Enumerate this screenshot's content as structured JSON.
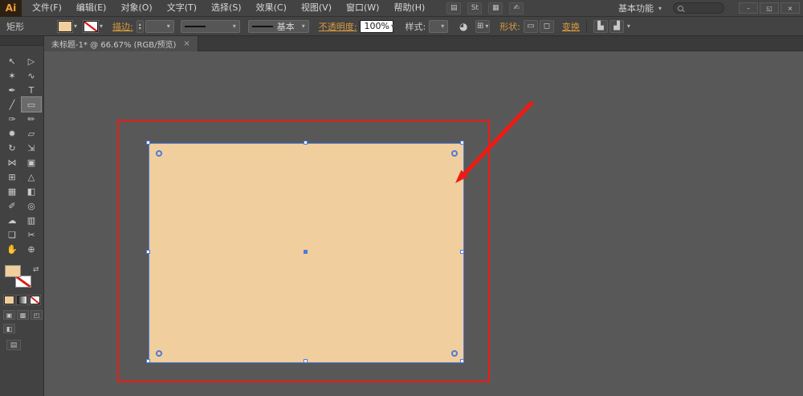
{
  "app": {
    "logo": "Ai"
  },
  "titlebar": {
    "menus": [
      "文件(F)",
      "编辑(E)",
      "对象(O)",
      "文字(T)",
      "选择(S)",
      "效果(C)",
      "视图(V)",
      "窗口(W)",
      "帮助(H)"
    ],
    "icons": {
      "arrange_documents": "▤",
      "st_badge": "St",
      "layout_picker": "▦",
      "cs_live": "✍",
      "caret": "▾"
    },
    "workspace": "基本功能",
    "search_placeholder": "",
    "window": {
      "minimize": "–",
      "restore": "◱",
      "close": "×"
    }
  },
  "controlbar": {
    "tool_label": "矩形",
    "stroke_label": "描边:",
    "spin_up": "▴",
    "spin_down": "▾",
    "brush_value": "基本",
    "opacity_label": "不透明度:",
    "opacity_value": "100%",
    "style_label": "样式:",
    "shape_label": "形状:",
    "transform_label": "变换",
    "caret": "▾",
    "icons": {
      "recolor": "◕",
      "grid": "⊞",
      "shape_a": "▭",
      "shape_b": "◻",
      "align_a": "▙",
      "align_b": "▟"
    }
  },
  "tab": {
    "title": "未标题-1* @ 66.67% (RGB/预览)",
    "close": "×"
  },
  "tools": [
    {
      "name": "selection-tool",
      "glyph": "↖"
    },
    {
      "name": "direct-selection-tool",
      "glyph": "▷"
    },
    {
      "name": "magic-wand-tool",
      "glyph": "✶"
    },
    {
      "name": "lasso-tool",
      "glyph": "∿"
    },
    {
      "name": "pen-tool",
      "glyph": "✒"
    },
    {
      "name": "type-tool",
      "glyph": "T"
    },
    {
      "name": "line-segment-tool",
      "glyph": "╱"
    },
    {
      "name": "rectangle-tool",
      "glyph": "▭"
    },
    {
      "name": "paintbrush-tool",
      "glyph": "✑"
    },
    {
      "name": "pencil-tool",
      "glyph": "✏"
    },
    {
      "name": "blob-brush-tool",
      "glyph": "✹"
    },
    {
      "name": "eraser-tool",
      "glyph": "▱"
    },
    {
      "name": "rotate-tool",
      "glyph": "↻"
    },
    {
      "name": "scale-tool",
      "glyph": "⇲"
    },
    {
      "name": "width-tool",
      "glyph": "⋈"
    },
    {
      "name": "free-transform-tool",
      "glyph": "▣"
    },
    {
      "name": "shape-builder-tool",
      "glyph": "⊞"
    },
    {
      "name": "perspective-grid-tool",
      "glyph": "△"
    },
    {
      "name": "mesh-tool",
      "glyph": "▦"
    },
    {
      "name": "gradient-tool",
      "glyph": "◧"
    },
    {
      "name": "eyedropper-tool",
      "glyph": "✐"
    },
    {
      "name": "blend-tool",
      "glyph": "◎"
    },
    {
      "name": "symbol-sprayer-tool",
      "glyph": "☁"
    },
    {
      "name": "column-graph-tool",
      "glyph": "▥"
    },
    {
      "name": "artboard-tool",
      "glyph": "❏"
    },
    {
      "name": "slice-tool",
      "glyph": "✂"
    },
    {
      "name": "hand-tool",
      "glyph": "✋"
    },
    {
      "name": "zoom-tool",
      "glyph": "⊕"
    }
  ],
  "colors": {
    "artwork_fill": "#F0CE9D",
    "annotation_red": "#EE1B12",
    "selection_blue": "#4F7BD9",
    "accent_orange": "#D89B3D",
    "canvas_gray": "#585858"
  }
}
